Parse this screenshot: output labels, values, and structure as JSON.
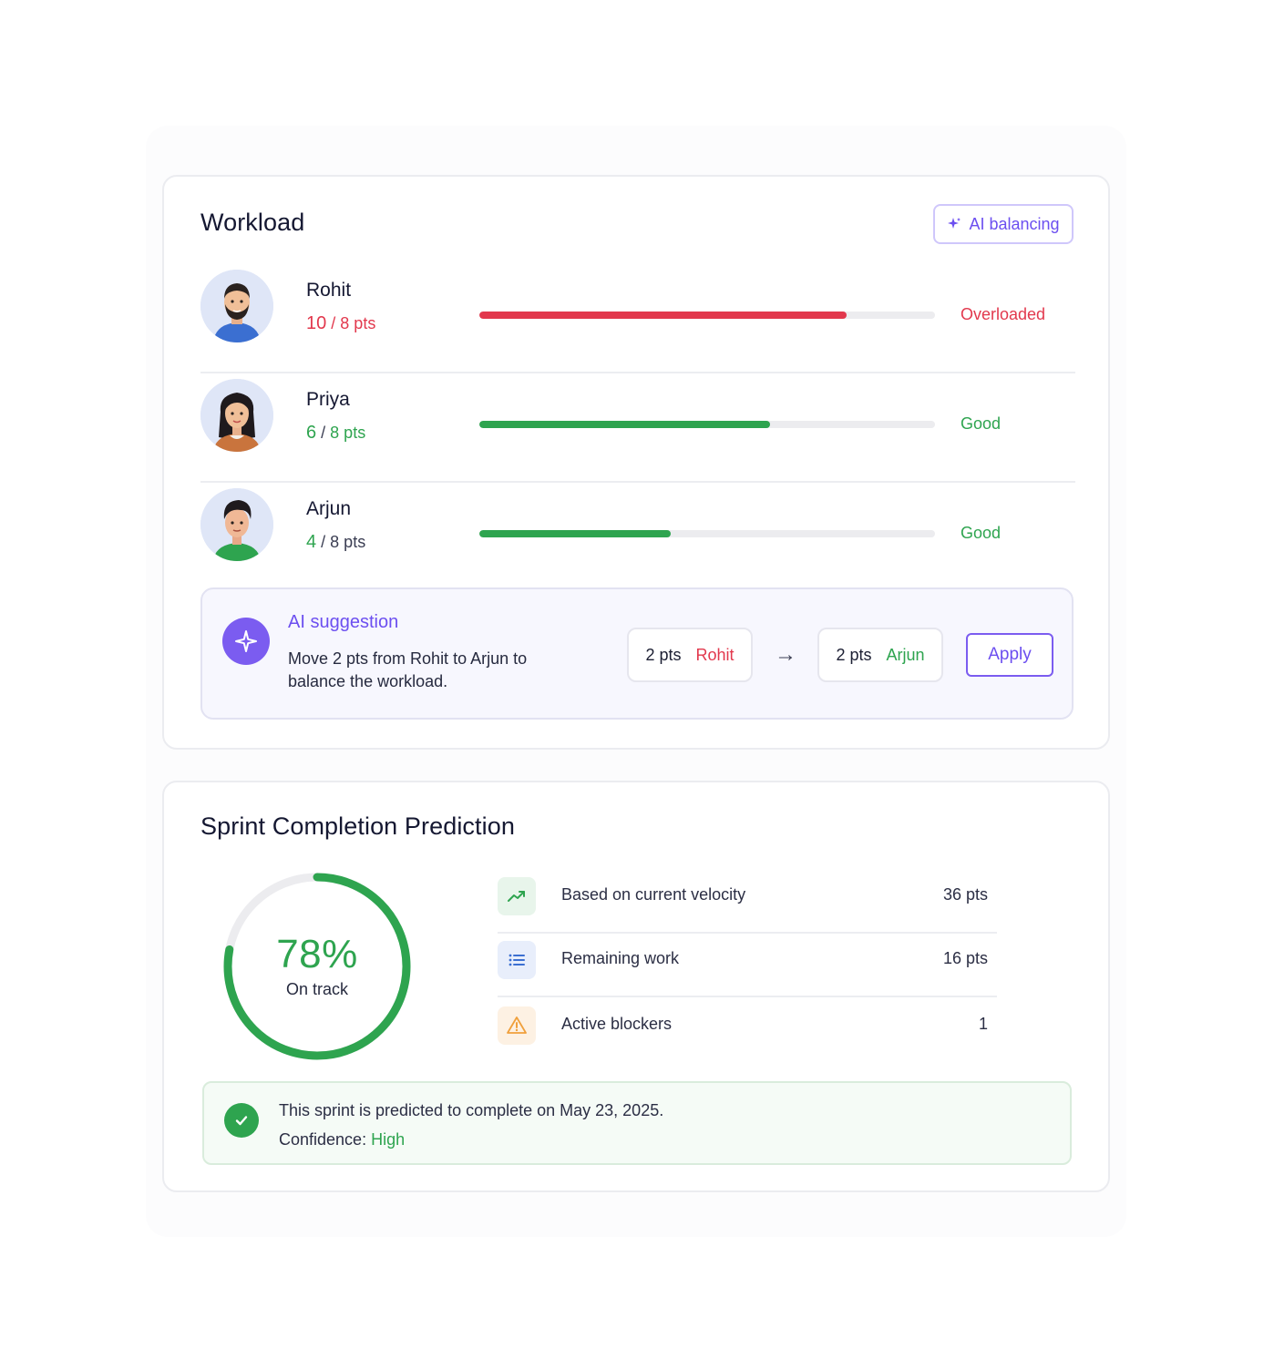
{
  "workload": {
    "title": "Workload",
    "ai_button_label": "AI balancing",
    "members": [
      {
        "name": "Rohit",
        "current": "10",
        "capacity": "8 pts",
        "load_fraction": 0.805,
        "status": "Overloaded",
        "tone": "red"
      },
      {
        "name": "Priya",
        "current": "6",
        "capacity": "8 pts",
        "load_fraction": 0.637,
        "status": "Good",
        "tone": "green"
      },
      {
        "name": "Arjun",
        "current": "4",
        "capacity": "8 pts",
        "load_fraction": 0.42,
        "status": "Good",
        "tone": "green"
      }
    ],
    "separator": "/",
    "suggestion": {
      "title": "AI suggestion",
      "text": "Move 2 pts from Rohit to Arjun to balance the workload.",
      "from_pts": "2 pts",
      "from_name": "Rohit",
      "arrow": "→",
      "to_pts": "2 pts",
      "to_name": "Arjun",
      "apply_label": "Apply"
    }
  },
  "sprint": {
    "title": "Sprint Completion Prediction",
    "progress_percent": 78,
    "progress_label": "78%",
    "progress_status": "On track",
    "stats": [
      {
        "icon": "trending-up-icon",
        "label": "Based on current velocity",
        "value": "36 pts"
      },
      {
        "icon": "list-icon",
        "label": "Remaining work",
        "value": "16 pts"
      },
      {
        "icon": "warning-icon",
        "label": "Active blockers",
        "value": "1"
      }
    ],
    "prediction_text": "This sprint is predicted to complete on May 23, 2025.",
    "confidence_label": "Confidence:",
    "confidence_value": "High"
  },
  "colors": {
    "accent_purple": "#6c4ff0",
    "danger_red": "#e2384d",
    "success_green": "#2ea44f",
    "warning_orange": "#f0a03c"
  }
}
